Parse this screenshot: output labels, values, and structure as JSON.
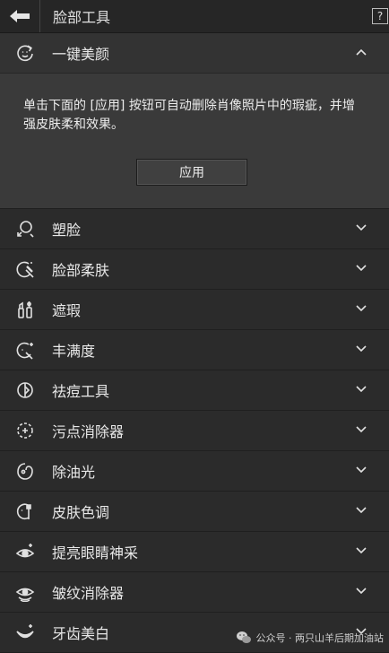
{
  "header": {
    "title": "脸部工具",
    "help_label": "?"
  },
  "expanded_section": {
    "label": "一键美颜",
    "icon": "beauty-refresh-icon",
    "description": "单击下面的 [应用] 按钮可自动删除肖像照片中的瑕疵，并增强皮肤柔和效果。",
    "apply_label": "应用"
  },
  "tools": [
    {
      "label": "塑脸",
      "icon": "face-shape-icon"
    },
    {
      "label": "脸部柔肤",
      "icon": "face-smooth-icon"
    },
    {
      "label": "遮瑕",
      "icon": "concealer-icon"
    },
    {
      "label": "丰满度",
      "icon": "fullness-icon"
    },
    {
      "label": "祛痘工具",
      "icon": "acne-tool-icon"
    },
    {
      "label": "污点消除器",
      "icon": "blemish-remover-icon"
    },
    {
      "label": "除油光",
      "icon": "shine-removal-icon"
    },
    {
      "label": "皮肤色调",
      "icon": "skin-tone-icon"
    },
    {
      "label": "提亮眼睛神采",
      "icon": "eye-brighten-icon"
    },
    {
      "label": "皱纹消除器",
      "icon": "wrinkle-remover-icon"
    },
    {
      "label": "牙齿美白",
      "icon": "teeth-whiten-icon"
    }
  ],
  "watermark": {
    "text": "公众号 · 两只山羊后期加油站"
  },
  "colors": {
    "panel_bg": "#2b2b2b",
    "expanded_bg": "#3a3a3a",
    "text": "#e8e8e8",
    "icon": "#e0e0e0"
  }
}
